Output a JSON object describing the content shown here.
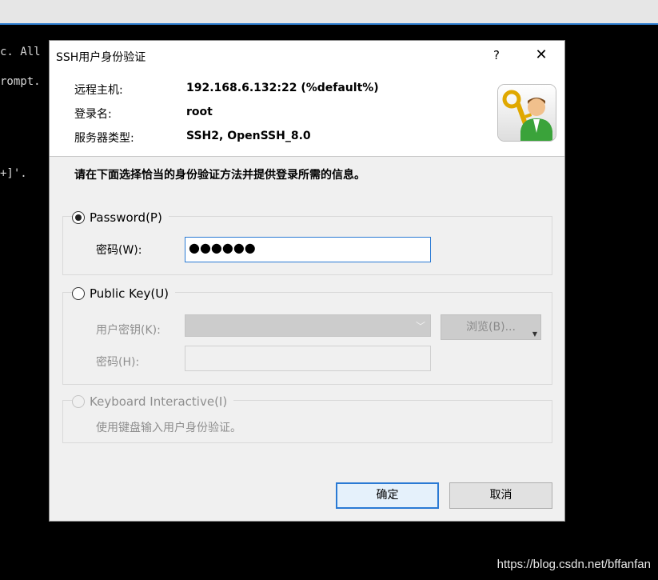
{
  "terminal": {
    "lines": [
      "c. All",
      "rompt.",
      "+]'."
    ]
  },
  "watermark": "https://blog.csdn.net/bffanfan",
  "dialog": {
    "title": "SSH用户身份验证",
    "help_label": "?",
    "close_label": "✕",
    "info": {
      "host_label": "远程主机:",
      "host_value": "192.168.6.132:22 (%default%)",
      "login_label": "登录名:",
      "login_value": "root",
      "server_label": "服务器类型:",
      "server_value": "SSH2, OpenSSH_8.0"
    },
    "instruction": "请在下面选择恰当的身份验证方法并提供登录所需的信息。",
    "password_group": {
      "radio_label": "Password(P)",
      "checked": true,
      "field_label": "密码(W):",
      "field_value": "●●●●●●"
    },
    "publickey_group": {
      "radio_label": "Public Key(U)",
      "checked": false,
      "userkey_label": "用户密钥(K):",
      "userkey_value": "",
      "browse_label": "浏览(B)...",
      "passphrase_label": "密码(H):",
      "passphrase_value": ""
    },
    "keyboard_group": {
      "radio_label": "Keyboard Interactive(I)",
      "checked": false,
      "description": "使用键盘输入用户身份验证。"
    },
    "ok_label": "确定",
    "cancel_label": "取消"
  },
  "colors": {
    "accent": "#2a7ad4",
    "dialog_bg": "#f0f0f0",
    "terminal_bg": "#000000"
  },
  "icons": [
    "key-user-icon",
    "close-icon",
    "help-icon",
    "chevron-down-icon"
  ]
}
